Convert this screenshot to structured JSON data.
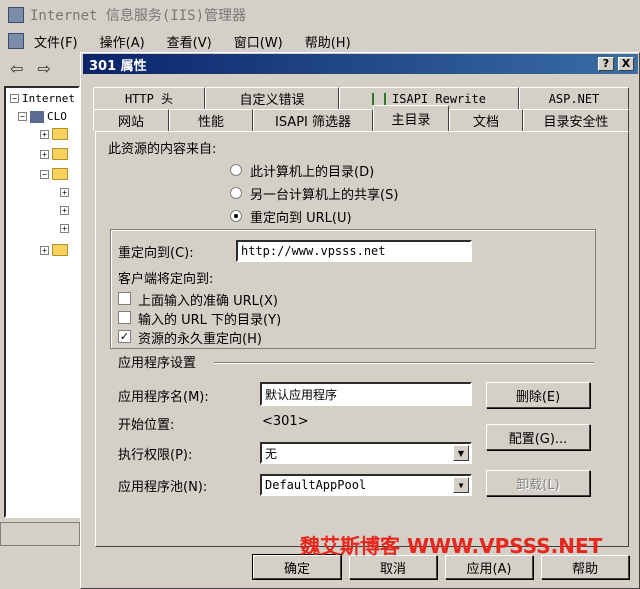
{
  "manager": {
    "title": "Internet 信息服务(IIS)管理器",
    "menu": [
      "文件(F)",
      "操作(A)",
      "查看(V)",
      "窗口(W)",
      "帮助(H)"
    ],
    "tree_root": "Internet",
    "tree_computer": "CLO"
  },
  "dialog": {
    "title": "301 属性",
    "help_btn": "?",
    "close_btn": "X",
    "tabs_row1": [
      "HTTP 头",
      "自定义错误",
      "ISAPI_Rewrite",
      "ASP.NET"
    ],
    "tabs_row2": [
      "网站",
      "性能",
      "ISAPI 筛选器",
      "主目录",
      "文档",
      "目录安全性"
    ],
    "active_tab": "主目录",
    "content_source_label": "此资源的内容来自:",
    "radio_options": [
      {
        "label": "此计算机上的目录(D)",
        "checked": false
      },
      {
        "label": "另一台计算机上的共享(S)",
        "checked": false
      },
      {
        "label": "重定向到 URL(U)",
        "checked": true
      }
    ],
    "redirect_label": "重定向到(C):",
    "redirect_value": "http://www.vpsss.net",
    "client_redirect_label": "客户端将定向到:",
    "checkboxes": [
      {
        "label": "上面输入的准确 URL(X)",
        "checked": false
      },
      {
        "label": "输入的 URL 下的目录(Y)",
        "checked": false
      },
      {
        "label": "资源的永久重定向(H)",
        "checked": true
      }
    ],
    "app_settings_label": "应用程序设置",
    "app_name_label": "应用程序名(M):",
    "app_name_value": "默认应用程序",
    "start_label": "开始位置:",
    "start_value": "<301>",
    "exec_perm_label": "执行权限(P):",
    "exec_perm_value": "无",
    "app_pool_label": "应用程序池(N):",
    "app_pool_value": "DefaultAppPool",
    "remove_btn": "删除(E)",
    "config_btn": "配置(G)...",
    "unload_btn": "卸载(L)",
    "ok_btn": "确定",
    "cancel_btn": "取消",
    "apply_btn": "应用(A)",
    "help_button": "帮助"
  },
  "watermark": "魏艾斯博客 WWW.VPSSS.NET"
}
